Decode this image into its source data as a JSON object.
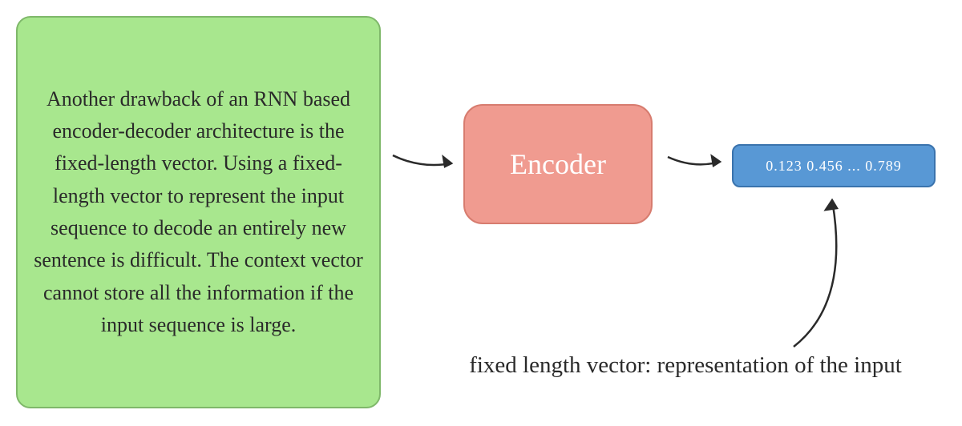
{
  "input_text": "Another drawback of an RNN based encoder-decoder architecture is the fixed-length vector. Using a fixed-length vector to represent the input sequence to decode an entirely new sentence is difficult. The context vector cannot store all the information if the input sequence is large.",
  "encoder_label": "Encoder",
  "vector_content": "0.123 0.456 ... 0.789",
  "caption_text": "fixed length vector: representation of the input",
  "colors": {
    "green_bg": "#a8e78e",
    "green_border": "#7fb86a",
    "red_bg": "#f09b90",
    "red_border": "#d77c6f",
    "blue_bg": "#5898d5",
    "blue_border": "#3a73ad",
    "text_dark": "#2a2a2a",
    "text_light": "#ffffff"
  }
}
